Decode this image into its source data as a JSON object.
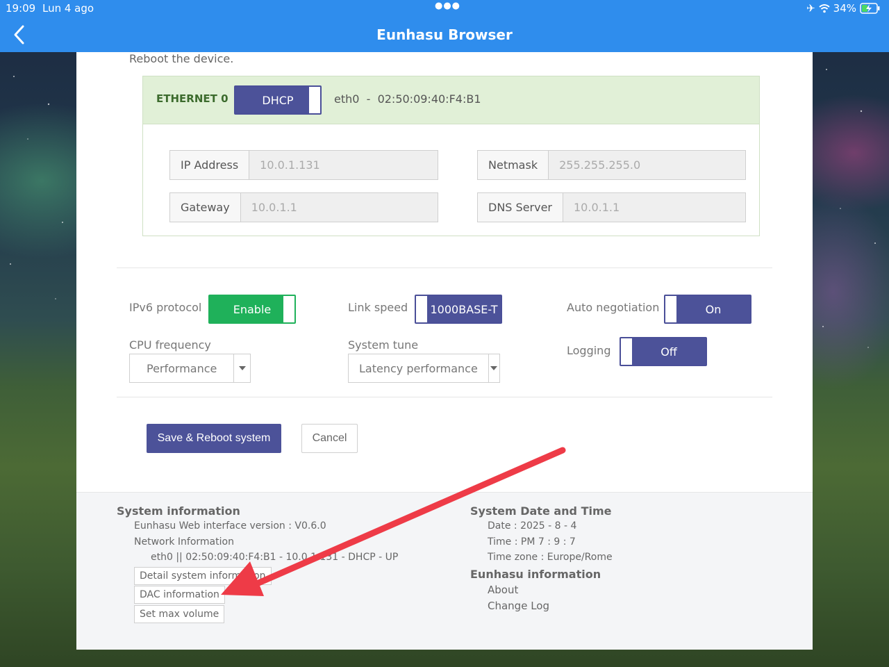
{
  "status_bar": {
    "time": "19:09",
    "date": "Lun 4 ago",
    "battery": "34%"
  },
  "nav": {
    "title": "Eunhasu Browser"
  },
  "content": {
    "lead": "Reboot the device.",
    "ethernet": {
      "label": "ETHERNET 0",
      "mode": "DHCP",
      "interface": "eth0",
      "separator": "-",
      "mac": "02:50:09:40:F4:B1",
      "fields": {
        "ip_label": "IP Address",
        "ip_value": "10.0.1.131",
        "netmask_label": "Netmask",
        "netmask_value": "255.255.255.0",
        "gateway_label": "Gateway",
        "gateway_value": "10.0.1.1",
        "dns_label": "DNS Server",
        "dns_value": "10.0.1.1"
      }
    },
    "settings": {
      "ipv6_label": "IPv6 protocol",
      "ipv6_value": "Enable",
      "link_label": "Link speed",
      "link_value": "1000BASE-T",
      "autoneg_label": "Auto negotiation",
      "autoneg_value": "On",
      "cpu_label": "CPU frequency",
      "cpu_value": "Performance",
      "tune_label": "System tune",
      "tune_value": "Latency performance",
      "logging_label": "Logging",
      "logging_value": "Off"
    },
    "actions": {
      "save_label": "Save & Reboot system",
      "cancel_label": "Cancel"
    }
  },
  "footer": {
    "sysinfo_title": "System information",
    "web_version": "Eunhasu Web interface version : V0.6.0",
    "net_info": "Network Information",
    "net_line": "eth0 || 02:50:09:40:F4:B1 - 10.0.1.131 - DHCP - UP",
    "btn_detail": "Detail system information",
    "btn_dac": "DAC information",
    "btn_volume": "Set max volume",
    "datetime_title": "System Date and Time",
    "date_line": "Date : 2025 - 8 - 4",
    "time_line": "Time :  PM 7 : 9 : 7",
    "tz_line": "Time zone : Europe/Rome",
    "eunhasu_title": "Eunhasu information",
    "about": "About",
    "changelog": "Change Log"
  },
  "colors": {
    "accent_blue": "#2f8ded",
    "toggle_indigo": "#4c5299",
    "toggle_green": "#1fb15a",
    "annotation_red": "#ee3b47"
  }
}
